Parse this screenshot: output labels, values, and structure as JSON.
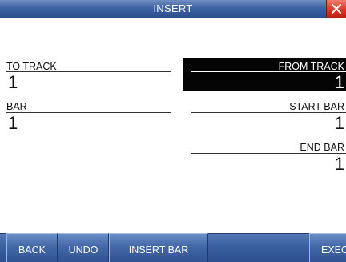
{
  "window": {
    "title": "INSERT"
  },
  "fields": {
    "to_track": {
      "label": "TO TRACK",
      "value": "1"
    },
    "bar": {
      "label": "BAR",
      "value": "1"
    },
    "from_track": {
      "label": "FROM TRACK",
      "value": "1"
    },
    "start_bar": {
      "label": "START BAR",
      "value": "1"
    },
    "end_bar": {
      "label": "END BAR",
      "value": "1"
    }
  },
  "buttons": {
    "back": "BACK",
    "undo": "UNDO",
    "insert_bar": "INSERT BAR",
    "exec": "EXEC"
  },
  "colors": {
    "titlebar": "#3f64a3",
    "close": "#d8331f",
    "selected_field_bg": "#050505",
    "button": "#4368a8"
  },
  "icons": {
    "close": "close-icon"
  }
}
